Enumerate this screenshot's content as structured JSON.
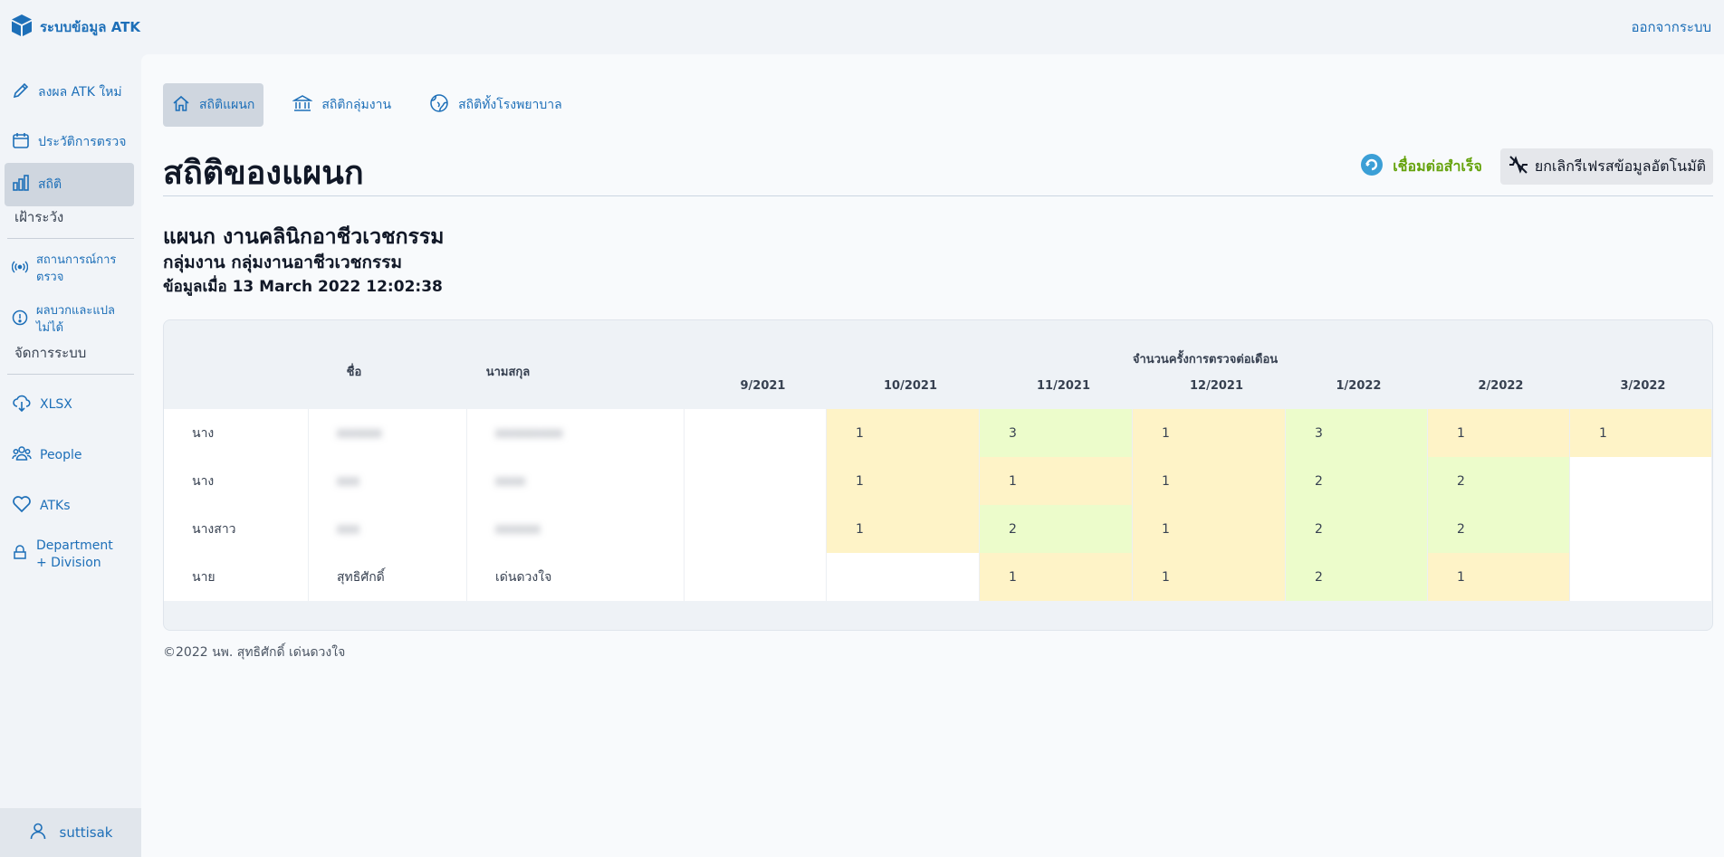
{
  "app": {
    "title": "ระบบข้อมูล ATK",
    "logout": "ออกจากระบบ"
  },
  "sidebar": {
    "items": [
      {
        "label": "ลงผล ATK ใหม่",
        "icon": "pencil-icon"
      },
      {
        "label": "ประวัติการตรวจ",
        "icon": "calendar-icon"
      },
      {
        "label": "สถิติ",
        "icon": "bar-chart-icon"
      }
    ],
    "surveillance_heading": "เฝ้าระวัง",
    "surveillance_items": [
      {
        "label": "สถานการณ์การตรวจ",
        "icon": "broadcast-icon"
      },
      {
        "label": "ผลบวกและแปลไม่ได้",
        "icon": "alert-circle-icon"
      }
    ],
    "admin_heading": "จัดการระบบ",
    "admin_items": [
      {
        "label": "XLSX",
        "icon": "cloud-download-icon"
      },
      {
        "label": "People",
        "icon": "people-icon"
      },
      {
        "label": "ATKs",
        "icon": "heart-icon"
      },
      {
        "label": "Department + Division",
        "icon": "building-icon"
      }
    ],
    "user": "suttisak"
  },
  "tabs": [
    {
      "label": "สถิติแผนก",
      "icon": "home-icon"
    },
    {
      "label": "สถิติกลุ่มงาน",
      "icon": "bank-icon"
    },
    {
      "label": "สถิติทั้งโรงพยาบาล",
      "icon": "globe-icon"
    }
  ],
  "page": {
    "title": "สถิติของแผนก",
    "connection_status": "เชื่อมต่อสำเร็จ",
    "refresh_toggle": "ยกเลิกรีเฟรสข้อมูลอัตโนมัติ",
    "department": "แผนก งานคลินิกอาชีวเวชกรรม",
    "division": "กลุ่มงาน กลุ่มงานอาชีวเวชกรรม",
    "updated": "ข้อมูลเมื่อ 13 March 2022 12:02:38"
  },
  "table": {
    "group_header": "จำนวนครั้งการตรวจต่อเดือน",
    "col_firstname": "ชื่อ",
    "col_lastname": "นามสกุล",
    "months": [
      "9/2021",
      "10/2021",
      "11/2021",
      "12/2021",
      "1/2022",
      "2/2022",
      "3/2022"
    ],
    "rows": [
      {
        "prefix": "นาง",
        "first": "xxxxxx",
        "last": "xxxxxxxxx",
        "counts": [
          "",
          "1",
          "3",
          "1",
          "3",
          "1",
          "1"
        ]
      },
      {
        "prefix": "นาง",
        "first": "xxx",
        "last": "xxxx",
        "counts": [
          "",
          "1",
          "1",
          "1",
          "2",
          "2",
          ""
        ]
      },
      {
        "prefix": "นางสาว",
        "first": "xxx",
        "last": "xxxxxx",
        "counts": [
          "",
          "1",
          "2",
          "1",
          "2",
          "2",
          ""
        ]
      },
      {
        "prefix": "นาย",
        "first": "สุทธิศักดิ์",
        "last": "เด่นดวงใจ",
        "counts": [
          "",
          "",
          "1",
          "1",
          "2",
          "1",
          ""
        ]
      }
    ],
    "colors": {
      "low": "#fef3c7",
      "high": "#ecfccb"
    }
  },
  "footer": "©2022 นพ. สุทธิศักดิ์ เด่นดวงใจ"
}
